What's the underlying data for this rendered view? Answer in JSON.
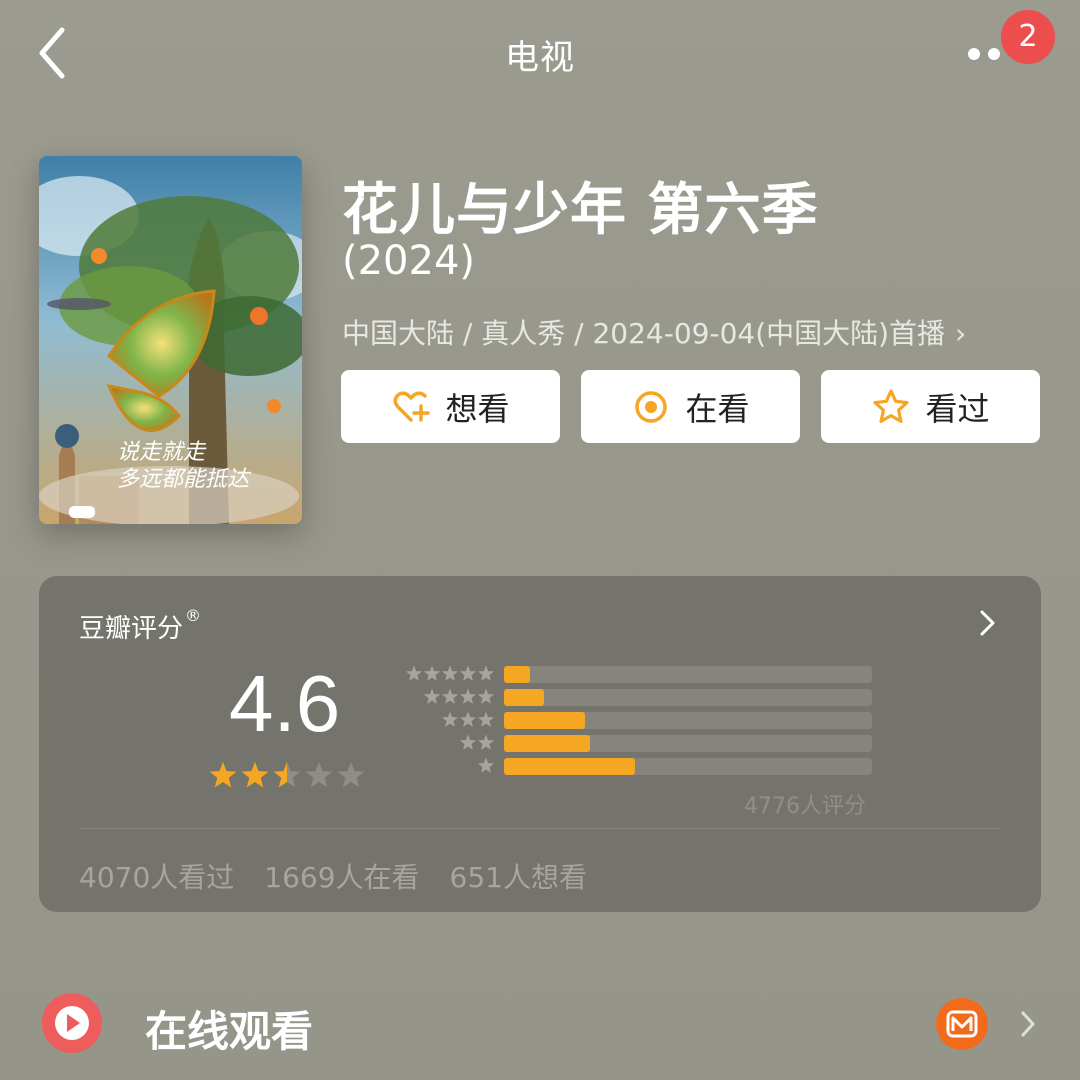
{
  "nav": {
    "title": "电视",
    "notification_count": "2"
  },
  "movie": {
    "title": "花儿与少年 第六季",
    "year": "(2024)",
    "meta": "中国大陆 / 真人秀 / 2024-09-04(中国大陆)首播",
    "poster_text_line1": "说走就走",
    "poster_text_line2": "多远都能抵达"
  },
  "actions": {
    "want": "想看",
    "watching": "在看",
    "watched": "看过"
  },
  "rating": {
    "label": "豆瓣评分",
    "registered": "®",
    "score": "4.6",
    "stars_filled": 2.5,
    "stars_total": 5,
    "distribution": [
      {
        "stars": 5,
        "fraction": 0.07
      },
      {
        "stars": 4,
        "fraction": 0.11
      },
      {
        "stars": 3,
        "fraction": 0.22
      },
      {
        "stars": 2,
        "fraction": 0.235
      },
      {
        "stars": 1,
        "fraction": 0.355
      }
    ],
    "count": "4776人评分"
  },
  "stats": {
    "watched": "4070人看过",
    "watching": "1669人在看",
    "want": "651人想看"
  },
  "watch": {
    "label": "在线观看"
  },
  "colors": {
    "accent": "#f5a623",
    "badge": "#ec4e4e",
    "play": "#ee5c5c",
    "provider": "#f26b1d"
  }
}
